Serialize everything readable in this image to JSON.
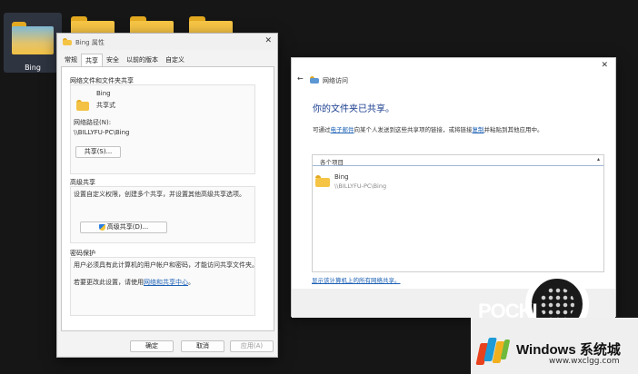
{
  "desktop": {
    "folders": [
      {
        "label": "Bing"
      },
      {
        "label": ""
      },
      {
        "label": ""
      },
      {
        "label": ""
      }
    ]
  },
  "properties": {
    "title": "Bing 属性",
    "close": "✕",
    "tabs": [
      "常规",
      "共享",
      "安全",
      "以前的版本",
      "自定义"
    ],
    "active_tab": "共享",
    "network_sharing": {
      "title": "网络文件和文件夹共享",
      "folder_name": "Bing",
      "status": "共享式",
      "path_label": "网络路径(N):",
      "path": "\\\\BILLYFU-PC\\Bing",
      "share_button": "共享(S)..."
    },
    "advanced_sharing": {
      "title": "高级共享",
      "description": "设置自定义权限，创建多个共享，并设置其他高级共享选项。",
      "button": "高级共享(D)..."
    },
    "password_protection": {
      "title": "密码保护",
      "description": "用户必须具有此计算机的用户帐户和密码，才能访问共享文件夹。",
      "change_prefix": "若要更改此设置，请使用",
      "change_link": "网络和共享中心",
      "change_suffix": "。"
    },
    "buttons": {
      "ok": "确定",
      "cancel": "取消",
      "apply": "应用(A)"
    }
  },
  "network_access": {
    "back": "←",
    "title": "网络访问",
    "close": "✕",
    "heading": "你的文件夹已共享。",
    "desc_prefix": "可通过",
    "desc_link_email": "电子邮件",
    "desc_middle": "向某个人发送到这些共享项的链接，或将链接",
    "desc_link_copy": "复制",
    "desc_suffix": "并粘贴到其他应用中。",
    "list_header": "各个项目",
    "list_collapse": "▴",
    "item": {
      "name": "Bing",
      "path": "\\\\BILLYFU-PC\\Bing"
    },
    "show_all_link": "显示该计算机上的所有网络共享。"
  },
  "watermark": {
    "title": "Windows 系统城",
    "url": "www.wxclgg.com",
    "decor_text": "POCKI"
  },
  "colors": {
    "desktop_bg": "#161616",
    "folder": "#f6c445",
    "link": "#1a5fb4",
    "heading": "#1a3d8f"
  }
}
